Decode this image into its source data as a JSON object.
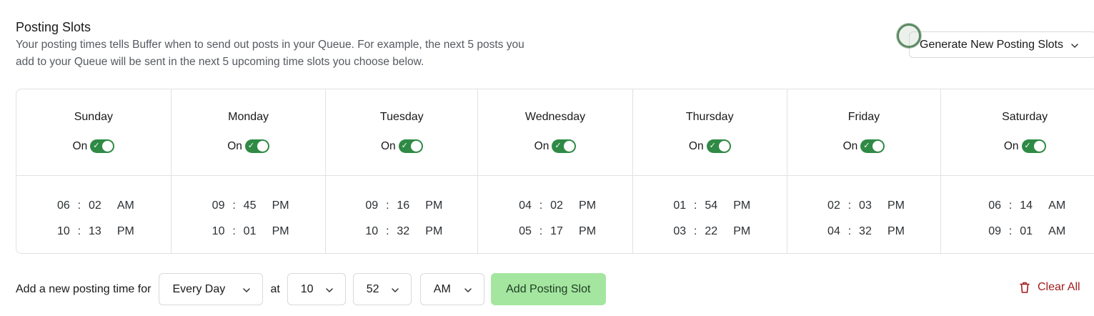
{
  "header": {
    "title": "Posting Slots",
    "description_line1": "Your posting times tells Buffer when to send out posts in your Queue. For example, the next 5 posts you",
    "description_line2": "add to your Queue will be sent in the next 5 upcoming time slots you choose below.",
    "generate_button": "Generate New Posting Slots"
  },
  "days": [
    {
      "name": "Sunday",
      "status": "On",
      "times": [
        {
          "h": "06",
          "m": "02",
          "ap": "AM"
        },
        {
          "h": "10",
          "m": "13",
          "ap": "PM"
        }
      ]
    },
    {
      "name": "Monday",
      "status": "On",
      "times": [
        {
          "h": "09",
          "m": "45",
          "ap": "PM"
        },
        {
          "h": "10",
          "m": "01",
          "ap": "PM"
        }
      ]
    },
    {
      "name": "Tuesday",
      "status": "On",
      "times": [
        {
          "h": "09",
          "m": "16",
          "ap": "PM"
        },
        {
          "h": "10",
          "m": "32",
          "ap": "PM"
        }
      ]
    },
    {
      "name": "Wednesday",
      "status": "On",
      "times": [
        {
          "h": "04",
          "m": "02",
          "ap": "PM"
        },
        {
          "h": "05",
          "m": "17",
          "ap": "PM"
        }
      ]
    },
    {
      "name": "Thursday",
      "status": "On",
      "times": [
        {
          "h": "01",
          "m": "54",
          "ap": "PM"
        },
        {
          "h": "03",
          "m": "22",
          "ap": "PM"
        }
      ]
    },
    {
      "name": "Friday",
      "status": "On",
      "times": [
        {
          "h": "02",
          "m": "03",
          "ap": "PM"
        },
        {
          "h": "04",
          "m": "32",
          "ap": "PM"
        }
      ]
    },
    {
      "name": "Saturday",
      "status": "On",
      "times": [
        {
          "h": "06",
          "m": "14",
          "ap": "AM"
        },
        {
          "h": "09",
          "m": "01",
          "ap": "AM"
        }
      ]
    }
  ],
  "add_slot": {
    "label": "Add a new posting time for",
    "day_value": "Every Day",
    "at_label": "at",
    "hour_value": "10",
    "minute_value": "52",
    "ampm_value": "AM",
    "add_button": "Add Posting Slot",
    "clear_button": "Clear All"
  },
  "colors": {
    "toggle_on": "#2f8a45",
    "add_button_bg": "#a4e6a0",
    "clear_text": "#a11d1d"
  }
}
